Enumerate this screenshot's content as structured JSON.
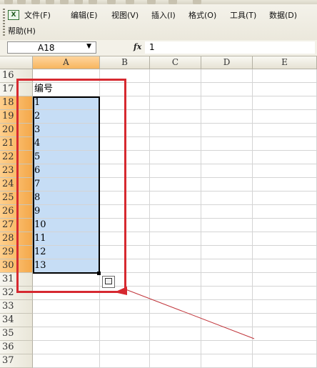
{
  "menu": {
    "file": "文件(F)",
    "edit": "编辑(E)",
    "view": "视图(V)",
    "insert": "插入(I)",
    "format": "格式(O)",
    "tools": "工具(T)",
    "data": "数据(D)",
    "help": "帮助(H)"
  },
  "formula_bar": {
    "name_box": "A18",
    "fx_label": "fx",
    "formula": "1"
  },
  "columns": [
    "A",
    "B",
    "C",
    "D",
    "E"
  ],
  "rows": [
    {
      "num": "16",
      "a": ""
    },
    {
      "num": "17",
      "a": "编号"
    },
    {
      "num": "18",
      "a": "1"
    },
    {
      "num": "19",
      "a": "2"
    },
    {
      "num": "20",
      "a": "3"
    },
    {
      "num": "21",
      "a": "4"
    },
    {
      "num": "22",
      "a": "5"
    },
    {
      "num": "23",
      "a": "6"
    },
    {
      "num": "24",
      "a": "7"
    },
    {
      "num": "25",
      "a": "8"
    },
    {
      "num": "26",
      "a": "9"
    },
    {
      "num": "27",
      "a": "10"
    },
    {
      "num": "28",
      "a": "11"
    },
    {
      "num": "29",
      "a": "12"
    },
    {
      "num": "30",
      "a": "13"
    },
    {
      "num": "31",
      "a": ""
    },
    {
      "num": "32",
      "a": ""
    },
    {
      "num": "33",
      "a": ""
    },
    {
      "num": "34",
      "a": ""
    },
    {
      "num": "35",
      "a": ""
    },
    {
      "num": "36",
      "a": ""
    },
    {
      "num": "37",
      "a": ""
    }
  ],
  "selection": {
    "first_row": "18",
    "last_row": "30",
    "column": "A"
  },
  "colors": {
    "selection_fill": "#c6ddf5",
    "annotation_red": "#d62930",
    "header_highlight": "#f7b55e"
  },
  "icons": {
    "app": "excel-sheet-icon",
    "autofill": "auto-fill-options-icon",
    "dropdown": "chevron-down-icon"
  }
}
